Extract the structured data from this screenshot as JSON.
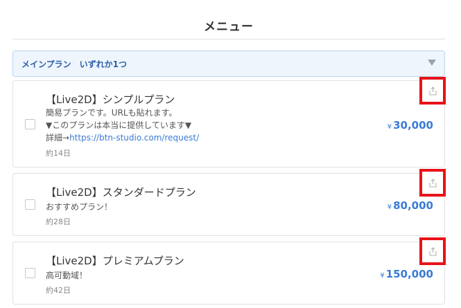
{
  "header": {
    "title": "メニュー"
  },
  "section": {
    "label": "メインプラン　いずれか1つ"
  },
  "plans": [
    {
      "name": "【Live2D】シンプルプラン",
      "desc_lines": [
        "簡易プランです。URLも貼れます。",
        "▼このプランは本当に提供しています▼"
      ],
      "detail_prefix": "詳細→",
      "detail_link": "https://btn-studio.com/request/",
      "duration": "約14日",
      "currency": "¥",
      "price": "30,000"
    },
    {
      "name": "【Live2D】スタンダードプラン",
      "desc_lines": [
        "おすすめプラン！"
      ],
      "duration": "約28日",
      "currency": "¥",
      "price": "80,000"
    },
    {
      "name": "【Live2D】プレミアムプラン",
      "desc_lines": [
        "高可動域！"
      ],
      "duration": "約42日",
      "currency": "¥",
      "price": "150,000"
    }
  ],
  "colors": {
    "accent": "#3a7bd5",
    "highlight": "#e8121a",
    "section_bg": "#eef5fd"
  },
  "icons": {
    "share": "share-upload-icon",
    "dropdown": "caret-down-icon"
  }
}
